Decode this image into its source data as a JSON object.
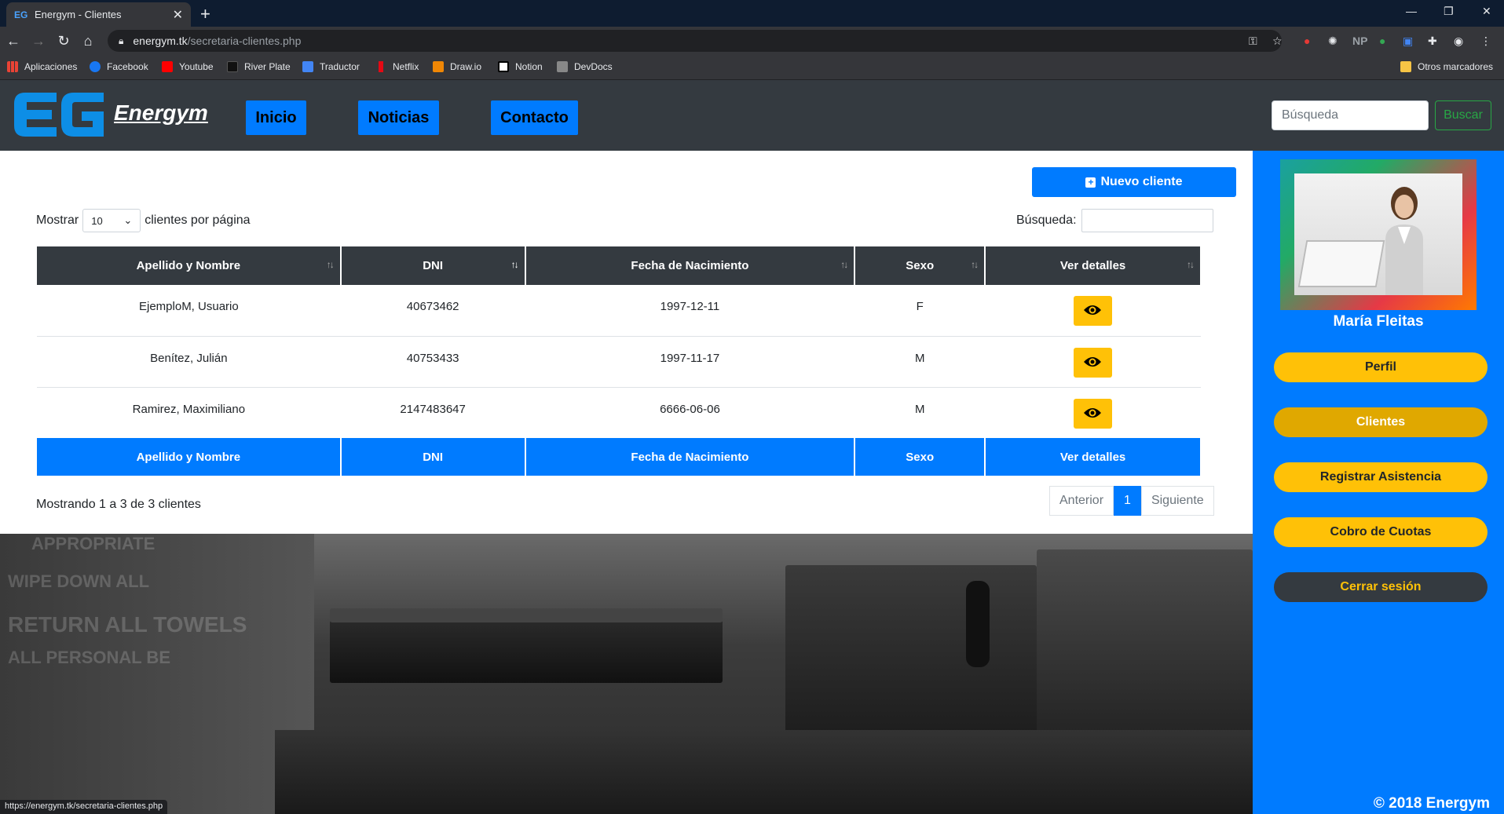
{
  "browser": {
    "tab_title": "Energym - Clientes",
    "url_host": "energym.tk",
    "url_path": "/secretaria-clientes.php",
    "status_url": "https://energym.tk/secretaria-clientes.php",
    "bookmarks": [
      "Aplicaciones",
      "Facebook",
      "Youtube",
      "River Plate",
      "Traductor",
      "Netflix",
      "Draw.io",
      "Notion",
      "DevDocs"
    ],
    "other_bookmarks": "Otros marcadores",
    "ext_np": "NP"
  },
  "header": {
    "brand": "Energym",
    "nav": [
      "Inicio",
      "Noticias",
      "Contacto"
    ],
    "search_placeholder": "Búsqueda",
    "search_button": "Buscar"
  },
  "main": {
    "new_client_button": "Nuevo cliente",
    "length_prefix": "Mostrar",
    "length_value": "10",
    "length_suffix": "clientes por página",
    "filter_label": "Búsqueda:",
    "columns": [
      "Apellido y Nombre",
      "DNI",
      "Fecha de Nacimiento",
      "Sexo",
      "Ver detalles"
    ],
    "rows": [
      {
        "name": "EjemploM, Usuario",
        "dni": "40673462",
        "birth": "1997-12-11",
        "sex": "F"
      },
      {
        "name": "Benítez, Julián",
        "dni": "40753433",
        "birth": "1997-11-17",
        "sex": "M"
      },
      {
        "name": "Ramirez, Maximiliano",
        "dni": "2147483647",
        "birth": "6666-06-06",
        "sex": "M"
      }
    ],
    "info": "Mostrando 1 a 3 de 3 clientes",
    "pager": {
      "prev": "Anterior",
      "page": "1",
      "next": "Siguiente"
    }
  },
  "sidebar": {
    "user_name": "María Fleitas",
    "buttons": [
      "Perfil",
      "Clientes",
      "Registrar Asistencia",
      "Cobro de Cuotas",
      "Cerrar sesión"
    ],
    "copyright": "© 2018 Energym"
  },
  "colors": {
    "primary": "#007bff",
    "warning": "#ffc107",
    "dark": "#343a40",
    "success": "#28a745"
  }
}
